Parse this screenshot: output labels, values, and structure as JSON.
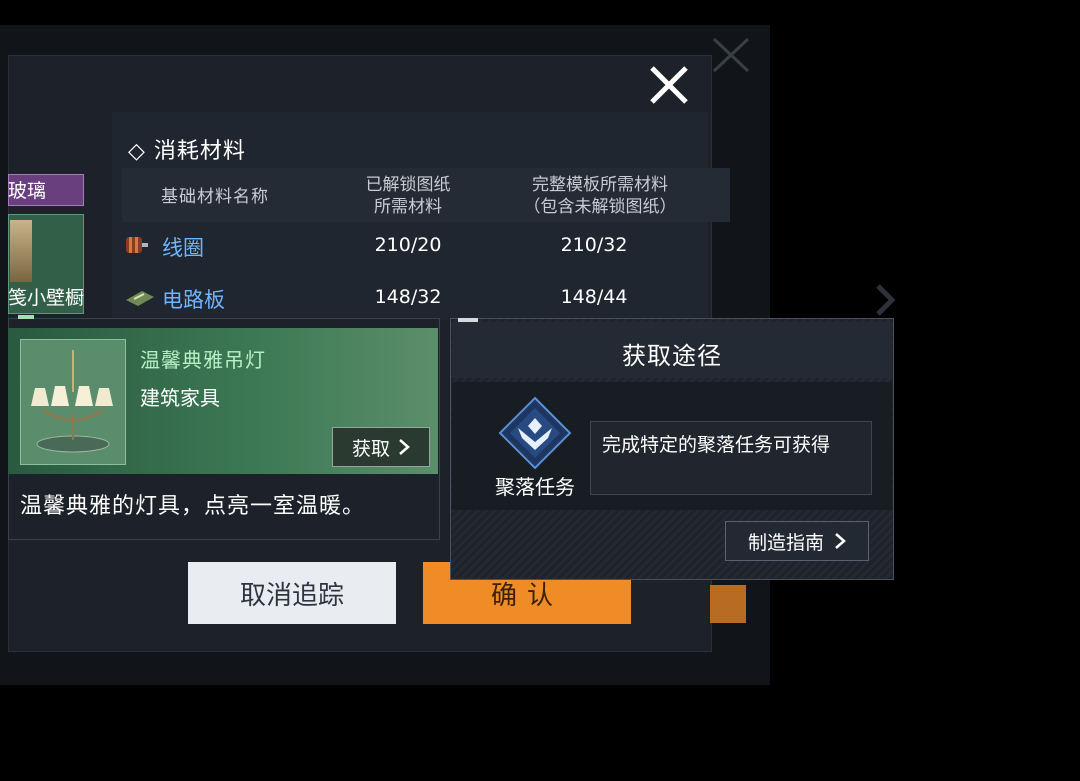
{
  "materials": {
    "section_title": "◇ 消耗材料",
    "headers": {
      "name": "基础材料名称",
      "unlocked_line1": "已解锁图纸",
      "unlocked_line2": "所需材料",
      "full_line1": "完整模板所需材料",
      "full_line2": "（包含未解锁图纸）"
    },
    "rows": [
      {
        "name": "线圈",
        "unlocked": "210/20",
        "full": "210/32",
        "icon": "coil-icon"
      },
      {
        "name": "电路板",
        "unlocked": "148/32",
        "full": "148/44",
        "icon": "circuit-board-icon"
      }
    ]
  },
  "left_strip": {
    "glass_label": "玻璃",
    "cabinet_label": "笺小壁橱"
  },
  "item": {
    "name": "温馨典雅吊灯",
    "category": "建筑家具",
    "obtain_label": "获取",
    "description": "温馨典雅的灯具，点亮一室温暖。",
    "icon": "chandelier-icon"
  },
  "buttons": {
    "cancel": "取消追踪",
    "confirm": "确认"
  },
  "acquisition": {
    "title": "获取途径",
    "source_label": "聚落任务",
    "source_icon": "settlement-quest-icon",
    "description": "完成特定的聚落任务可获得",
    "guide_label": "制造指南"
  },
  "colors": {
    "accent_orange": "#f08c25",
    "link_blue": "#6fb4ff",
    "item_green": "#3d7a55",
    "glass_purple": "#6a3f7e"
  }
}
